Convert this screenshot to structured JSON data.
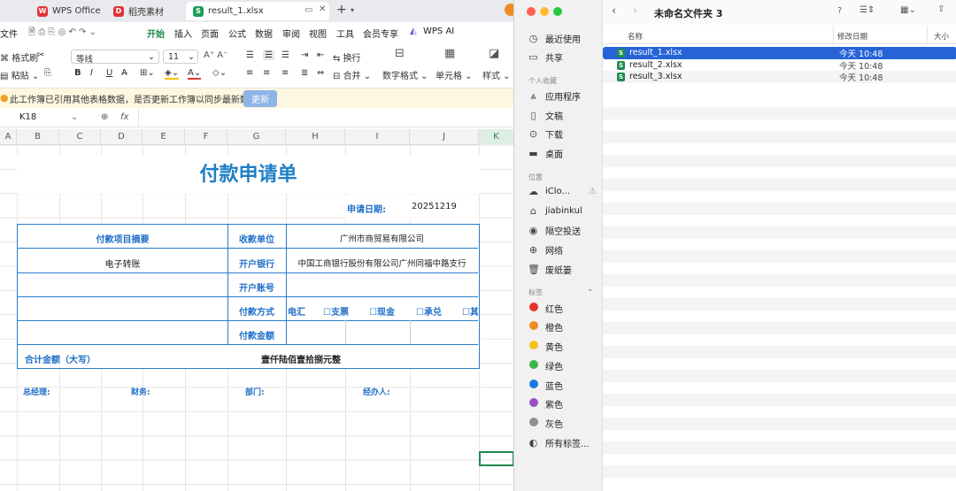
{
  "tabs": [
    {
      "label": "WPS Office",
      "icon": "W"
    },
    {
      "label": "稻壳素材",
      "icon": "D"
    },
    {
      "label": "result_1.xlsx",
      "icon": "S"
    }
  ],
  "menu": [
    "文件",
    "开始",
    "插入",
    "页面",
    "公式",
    "数据",
    "审阅",
    "视图",
    "工具",
    "会员专享",
    "WPS AI"
  ],
  "ribbon": {
    "format_painter": "格式刷",
    "paste": "粘贴",
    "font": "等线",
    "font_size": "11",
    "wrap": "换行",
    "merge": "合并",
    "number_format": "数字格式",
    "cell": "单元格",
    "style": "样式",
    "bold": "B",
    "italic": "I",
    "underline": "U"
  },
  "notice": {
    "text": "此工作簿已引用其他表格数据，是否更新工作簿以同步最新数据?",
    "button": "更新"
  },
  "formula_bar": {
    "cell_ref": "K18",
    "fx": "fx"
  },
  "columns": [
    "A",
    "B",
    "C",
    "D",
    "E",
    "F",
    "G",
    "H",
    "I",
    "J",
    "K"
  ],
  "sheet": {
    "title": "付款申请单",
    "date_label": "申请日期:",
    "date_value": "20251219",
    "item_summary_label": "付款项目摘要",
    "item_summary_value": "电子转账",
    "payee_label": "收款单位",
    "payee_value": "广州市商贸易有限公司",
    "bank_label": "开户银行",
    "bank_value": "中国工商银行股份有限公司广州同福中路支行",
    "account_label": "开户账号",
    "method_label": "付款方式",
    "methods": [
      "电汇",
      "☐支票",
      "☐现金",
      "☐承兑",
      "☐其"
    ],
    "amount_label": "付款金额",
    "total_label": "合计金额（大写）",
    "total_value": "壹仟陆佰壹拾捌元整",
    "sign_gm": "总经理:",
    "sign_finance": "财务:",
    "sign_dept": "部门:",
    "sign_handler": "经办人:"
  },
  "finder": {
    "folder_title": "未命名文件夹 3",
    "sidebar": {
      "recents": "最近使用",
      "shared": "共享",
      "favorites_header": "个人收藏",
      "favorites": [
        "应用程序",
        "文稿",
        "下载",
        "桌面"
      ],
      "locations_header": "位置",
      "locations": [
        "iClo...",
        "jiabinkul",
        "隔空投送",
        "网络",
        "废纸篓"
      ],
      "tags_header": "标签",
      "tags": [
        {
          "label": "红色",
          "color": "#e5322d"
        },
        {
          "label": "橙色",
          "color": "#f08a24"
        },
        {
          "label": "黄色",
          "color": "#f5c21b"
        },
        {
          "label": "绿色",
          "color": "#3bb54a"
        },
        {
          "label": "蓝色",
          "color": "#1f7ae0"
        },
        {
          "label": "紫色",
          "color": "#9a4fc4"
        },
        {
          "label": "灰色",
          "color": "#8e8e93"
        }
      ],
      "all_tags": "所有标签..."
    },
    "columns": {
      "name": "名称",
      "modified": "修改日期",
      "size": "大小"
    },
    "files": [
      {
        "name": "result_1.xlsx",
        "modified": "今天 10:48"
      },
      {
        "name": "result_2.xlsx",
        "modified": "今天 10:48"
      },
      {
        "name": "result_3.xlsx",
        "modified": "今天 10:48"
      }
    ]
  }
}
